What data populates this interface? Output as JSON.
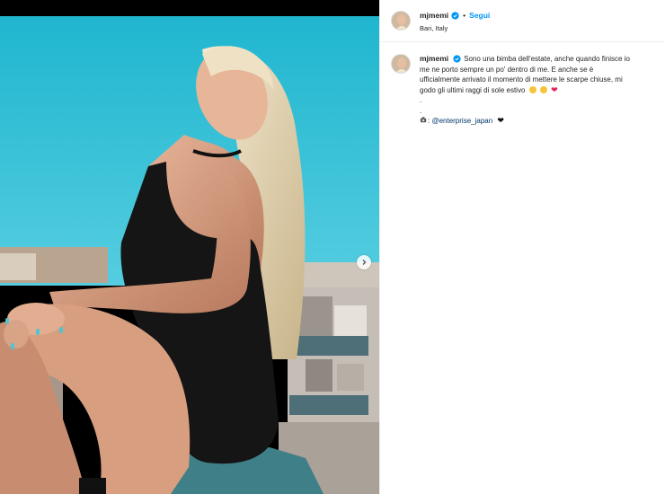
{
  "post": {
    "username": "mjmemi",
    "follow_label": "Segui",
    "separator": "•",
    "location": "Bari, Italy"
  },
  "caption": {
    "username": "mjmemi",
    "line1": "Sono una bimba dell'estate, anche quando finisce io",
    "line2": "me ne porto sempre un po' dentro di me. E anche se è",
    "line3": "ufficialmente arrivato il momento di mettere le scarpe chiuse, mi",
    "line4": "godo gli ultimi raggi di sole estivo",
    "dot1": ".",
    "dot2": ".",
    "credit_prefix": ": ",
    "credit_mention": "@enterprise_japan"
  },
  "icons": {
    "verified": "verified-badge-icon",
    "next": "chevron-right-icon",
    "camera": "camera-icon",
    "emoji1": "squinting-face-emoji",
    "emoji2": "smiling-face-emoji",
    "heart": "red-heart-emoji",
    "black_heart": "black-heart-emoji"
  },
  "colors": {
    "sky": "#2fc0d4",
    "link": "#0095f6",
    "mention": "#00376b",
    "heart": "#e0245e"
  }
}
